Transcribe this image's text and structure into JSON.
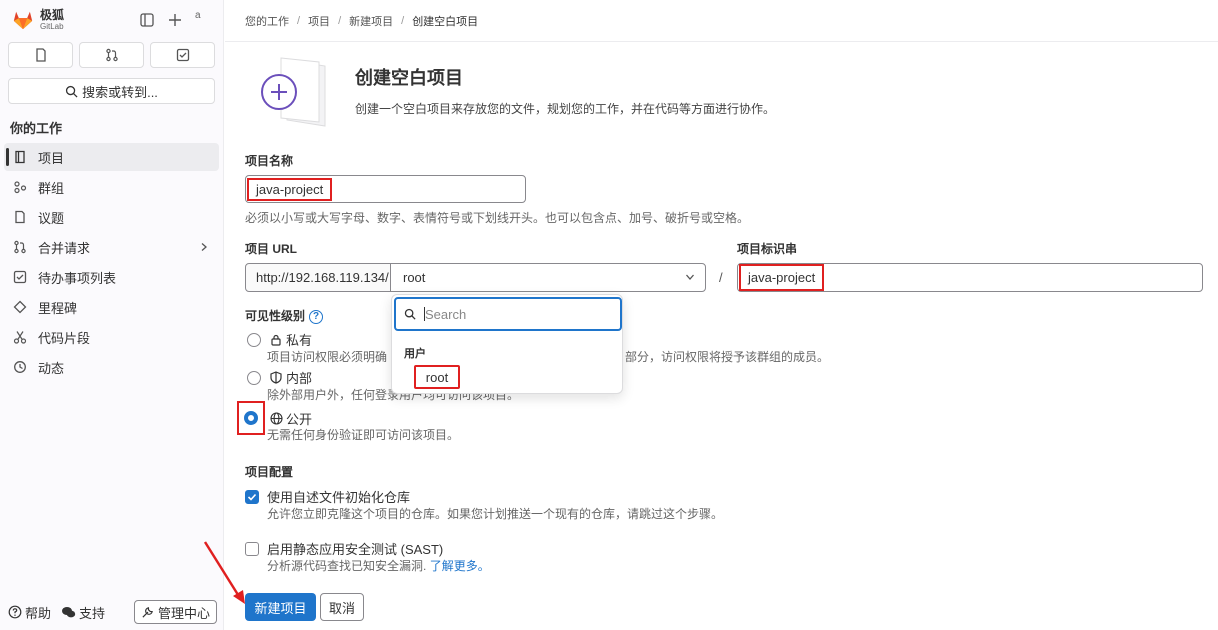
{
  "brand": {
    "name": "极狐",
    "sub": "GitLab",
    "avatar_alt": "a"
  },
  "sidebar": {
    "search_label": "搜索或转到...",
    "section_title": "你的工作",
    "items": [
      {
        "label": "项目",
        "icon": "project-icon"
      },
      {
        "label": "群组",
        "icon": "group-icon"
      },
      {
        "label": "议题",
        "icon": "issues-icon"
      },
      {
        "label": "合并请求",
        "icon": "merge-request-icon"
      },
      {
        "label": "待办事项列表",
        "icon": "todo-icon"
      },
      {
        "label": "里程碑",
        "icon": "milestone-icon"
      },
      {
        "label": "代码片段",
        "icon": "snippet-icon"
      },
      {
        "label": "动态",
        "icon": "activity-icon"
      }
    ],
    "help_label": "帮助",
    "support_label": "支持",
    "admin_label": "管理中心"
  },
  "breadcrumb": [
    "您的工作",
    "项目",
    "新建项目",
    "创建空白项目"
  ],
  "hero": {
    "title": "创建空白项目",
    "desc": "创建一个空白项目来存放您的文件，规划您的工作，并在代码等方面进行协作。"
  },
  "form": {
    "name_label": "项目名称",
    "name_value": "java-project",
    "name_help": "必须以小写或大写字母、数字、表情符号或下划线开头。也可以包含点、加号、破折号或空格。",
    "url_label": "项目 URL",
    "url_prefix": "http://192.168.119.134/",
    "namespace_value": "root",
    "slash": "/",
    "slug_label": "项目标识串",
    "slug_value": "java-project",
    "dropdown": {
      "search_placeholder": "Search",
      "group_label": "用户",
      "item": "root"
    },
    "visibility_label": "可见性级别",
    "visibility_help_icon": "?",
    "visibility": [
      {
        "label": "私有",
        "desc": "项目访问权限必须明确",
        "desc_tail": "部分，访问权限将授予该群组的成员。",
        "checked": false
      },
      {
        "label": "内部",
        "desc": "除外部用户外，任何登录用户均可访问该项目。",
        "checked": false
      },
      {
        "label": "公开",
        "desc": "无需任何身份验证即可访问该项目。",
        "checked": true
      }
    ],
    "config_label": "项目配置",
    "readme_label": "使用自述文件初始化仓库",
    "readme_desc": "允许您立即克隆这个项目的仓库。如果您计划推送一个现有的仓库，请跳过这个步骤。",
    "sast_label": "启用静态应用安全测试 (SAST)",
    "sast_desc": "分析源代码查找已知安全漏洞.",
    "sast_link": "了解更多。",
    "submit_label": "新建项目",
    "cancel_label": "取消"
  },
  "colors": {
    "primary": "#1f75cb",
    "annotation": "#e02020"
  }
}
